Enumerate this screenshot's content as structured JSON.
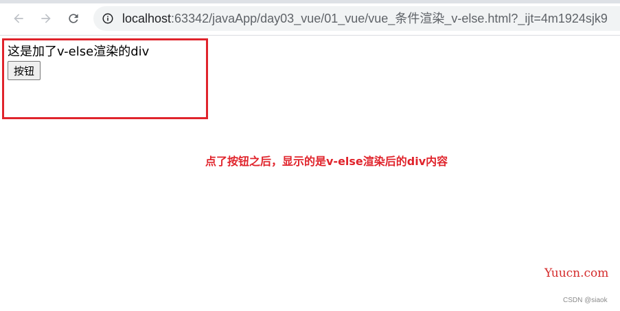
{
  "browser": {
    "url_host": "localhost",
    "url_path": ":63342/javaApp/day03_vue/01_vue/vue_条件渲染_v-else.html?_ijt=4m1924sjk9",
    "icons": {
      "back": "arrow-left-icon",
      "forward": "arrow-right-icon",
      "reload": "reload-icon",
      "site_info": "info-circle-icon"
    }
  },
  "page": {
    "div_text": "这是加了v-else渲染的div",
    "button_label": "按钮"
  },
  "annotation": {
    "text": "点了按钮之后，显示的是v-else渲染后的div内容"
  },
  "watermark": {
    "text": "Yuucn.com"
  },
  "credit": {
    "text": "CSDN @siaok"
  },
  "colors": {
    "highlight_border": "#e0232b",
    "annotation_text": "#e0232b"
  }
}
